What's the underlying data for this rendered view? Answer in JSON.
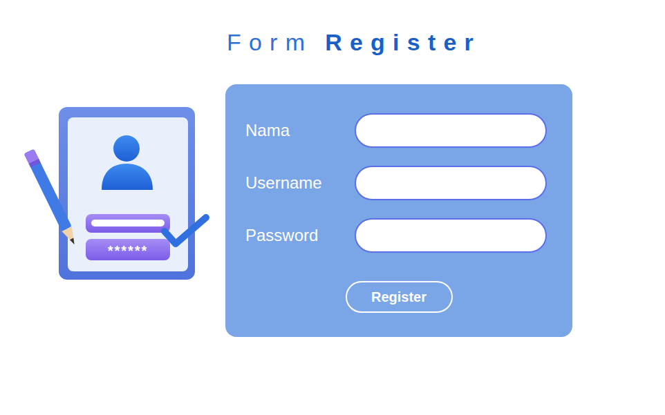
{
  "title": {
    "light": "Form",
    "bold": "Register"
  },
  "illustration": {
    "password_mask": "******"
  },
  "fields": [
    {
      "label": "Nama",
      "value": ""
    },
    {
      "label": "Username",
      "value": ""
    },
    {
      "label": "Password",
      "value": ""
    }
  ],
  "button": "Register"
}
